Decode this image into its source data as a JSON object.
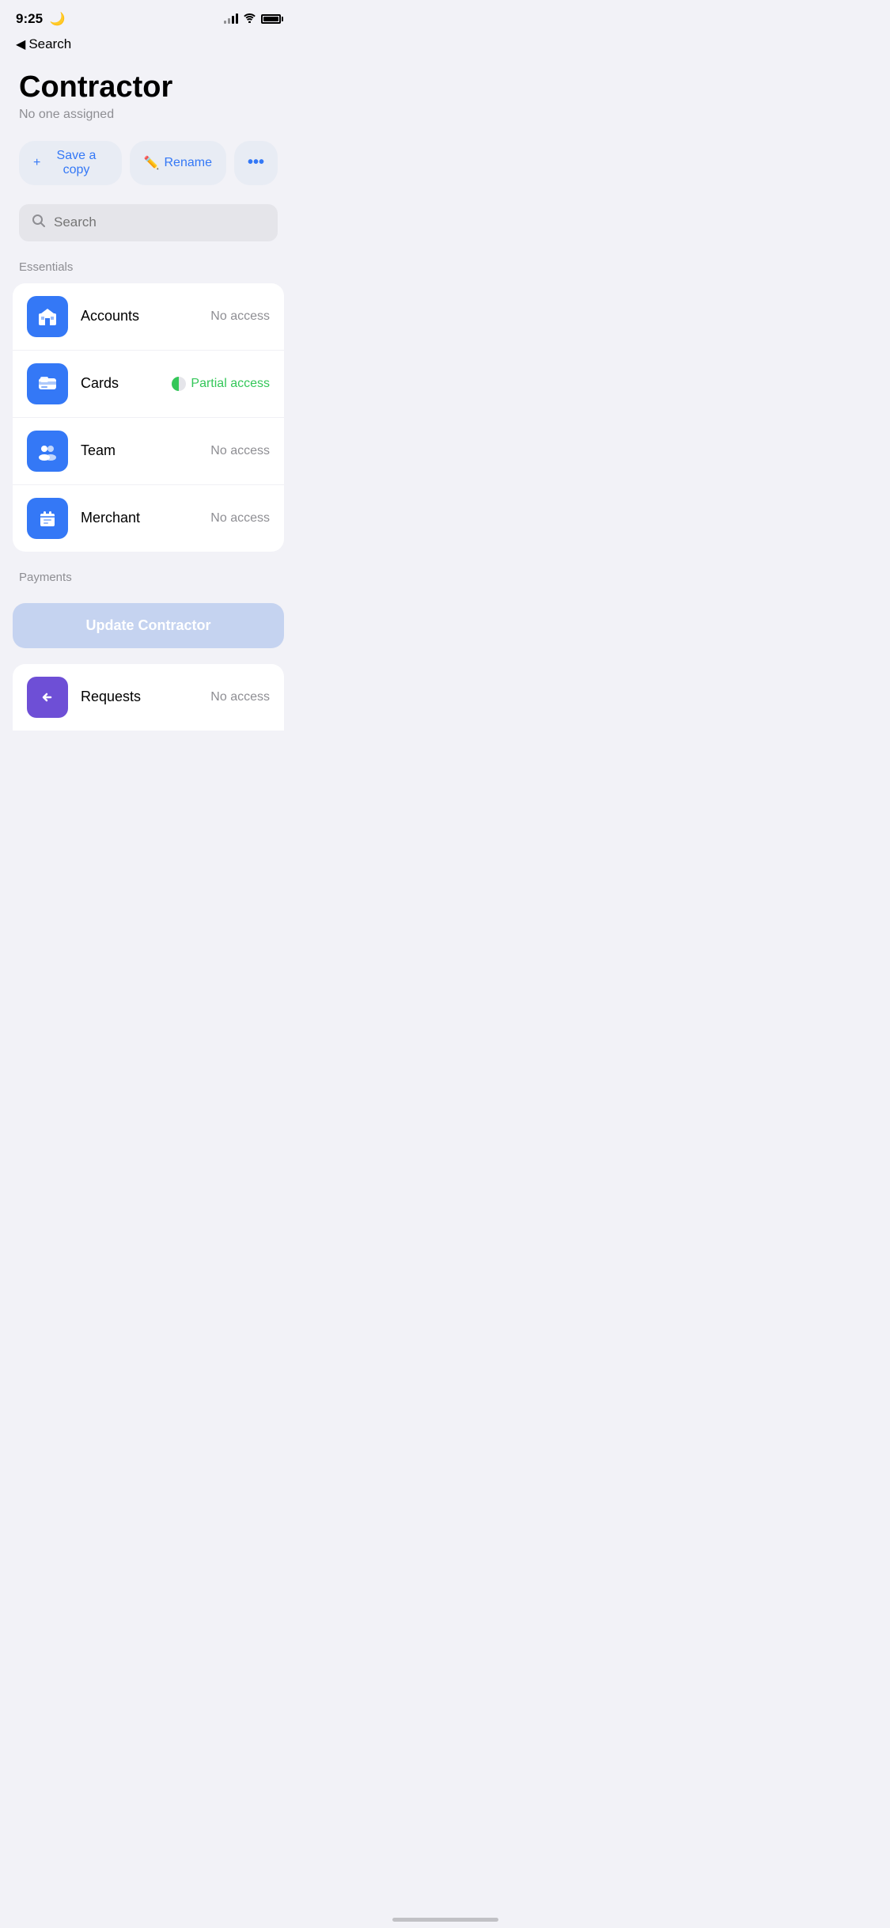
{
  "statusBar": {
    "time": "9:25",
    "moonIcon": "🌙"
  },
  "navBack": {
    "backArrow": "◀",
    "label": "Search"
  },
  "header": {
    "title": "Contractor",
    "subtitle": "No one assigned"
  },
  "actionButtons": {
    "saveCopy": "Save a copy",
    "rename": "Rename",
    "more": "•••"
  },
  "search": {
    "placeholder": "Search"
  },
  "sections": [
    {
      "label": "Essentials",
      "items": [
        {
          "name": "Accounts",
          "accessLabel": "No access",
          "accessType": "none",
          "iconType": "accounts"
        },
        {
          "name": "Cards",
          "accessLabel": "Partial access",
          "accessType": "partial",
          "iconType": "cards"
        },
        {
          "name": "Team",
          "accessLabel": "No access",
          "accessType": "none",
          "iconType": "team"
        },
        {
          "name": "Merchant",
          "accessLabel": "No access",
          "accessType": "none",
          "iconType": "merchant"
        }
      ]
    }
  ],
  "paymentsSection": {
    "label": "Payments"
  },
  "updateButton": {
    "label": "Update Contractor"
  },
  "bottomItem": {
    "name": "Requests",
    "accessLabel": "No access",
    "iconType": "requests"
  }
}
